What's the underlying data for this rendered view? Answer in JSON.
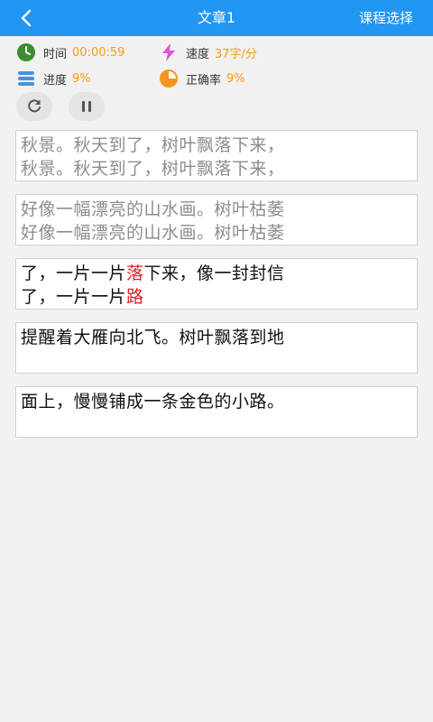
{
  "header": {
    "back_icon": "chevron-left-icon",
    "title": "文章1",
    "course_select": "课程选择"
  },
  "stats": {
    "time_label": "时间",
    "time_value": "00:00:59",
    "speed_label": "速度",
    "speed_value": "37字/分",
    "progress_label": "进度",
    "progress_value": "9%",
    "accuracy_label": "正确率",
    "accuracy_value": "9%"
  },
  "controls": {
    "refresh_icon": "refresh-icon",
    "pause_icon": "pause-icon"
  },
  "colors": {
    "header_bg": "#2196f3",
    "stat_value": "#f39c12",
    "error": "#e02020"
  },
  "passages": {
    "p1": {
      "source": "秋景。秋天到了，树叶飘落下来，",
      "typed": "秋景。秋天到了，树叶飘落下来，"
    },
    "p2": {
      "source": "好像一幅漂亮的山水画。树叶枯萎",
      "typed": "好像一幅漂亮的山水画。树叶枯萎"
    },
    "p3": {
      "source_a": "了，一片一片",
      "source_err": "落",
      "source_b": "下来，像一封封信",
      "typed_a": "了，一片一片",
      "typed_err": "路"
    },
    "p4": {
      "source": "提醒着大雁向北飞。树叶飘落到地"
    },
    "p5": {
      "source": "面上，慢慢铺成一条金色的小路。"
    }
  }
}
